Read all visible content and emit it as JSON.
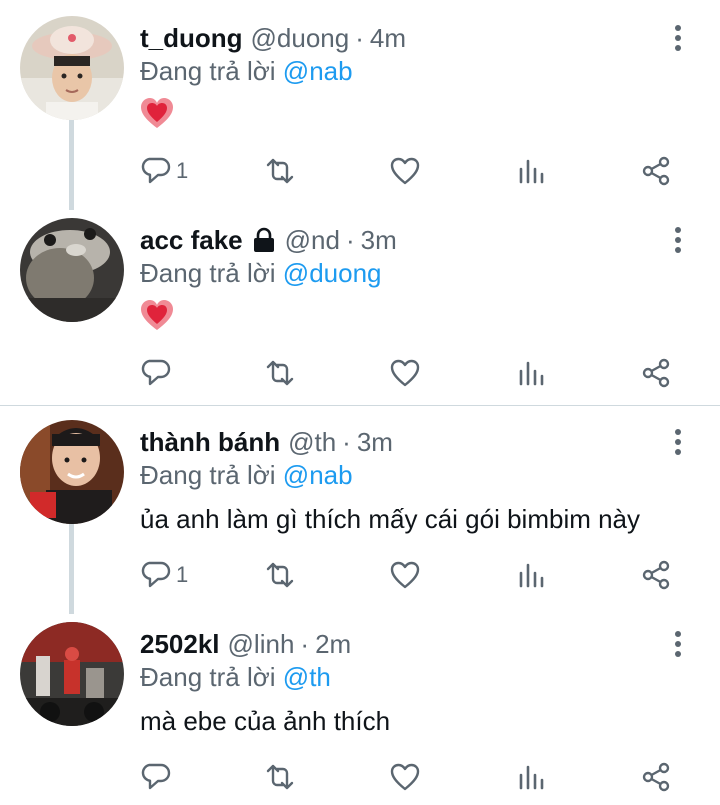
{
  "tweets": [
    {
      "name": "t_duong",
      "handle": "@duong",
      "dot": "·",
      "time": "4m",
      "replying_prefix": "Đang trả lời",
      "replying_to": "@nab",
      "text": "",
      "emoji": "heart",
      "reply_count": "1",
      "locked": false
    },
    {
      "name": "acc fake",
      "handle": "@nd",
      "dot": "·",
      "time": "3m",
      "replying_prefix": "Đang trả lời",
      "replying_to": "@duong",
      "text": "",
      "emoji": "heart",
      "reply_count": "",
      "locked": true
    },
    {
      "name": "thành bánh",
      "handle": "@th",
      "dot": "·",
      "time": "3m",
      "replying_prefix": "Đang trả lời",
      "replying_to": "@nab",
      "text": "ủa anh làm gì thích mấy cái gói bimbim này",
      "emoji": "",
      "reply_count": "1",
      "locked": false
    },
    {
      "name": "2502kl",
      "handle": "@linh",
      "dot": "·",
      "time": "2m",
      "replying_prefix": "Đang trả lời",
      "replying_to": "@th",
      "text": "mà ebe của ảnh thích",
      "emoji": "",
      "reply_count": "",
      "locked": false
    }
  ],
  "icons": {
    "reply": "reply-icon",
    "retweet": "retweet-icon",
    "like": "like-icon",
    "views": "views-icon",
    "share": "share-icon",
    "more": "more-icon",
    "lock": "lock-icon",
    "emoji": "heart-emoji"
  },
  "colors": {
    "link": "#1d9bf0",
    "secondary_text": "#5b6670",
    "thread_line": "#cfd9de"
  }
}
